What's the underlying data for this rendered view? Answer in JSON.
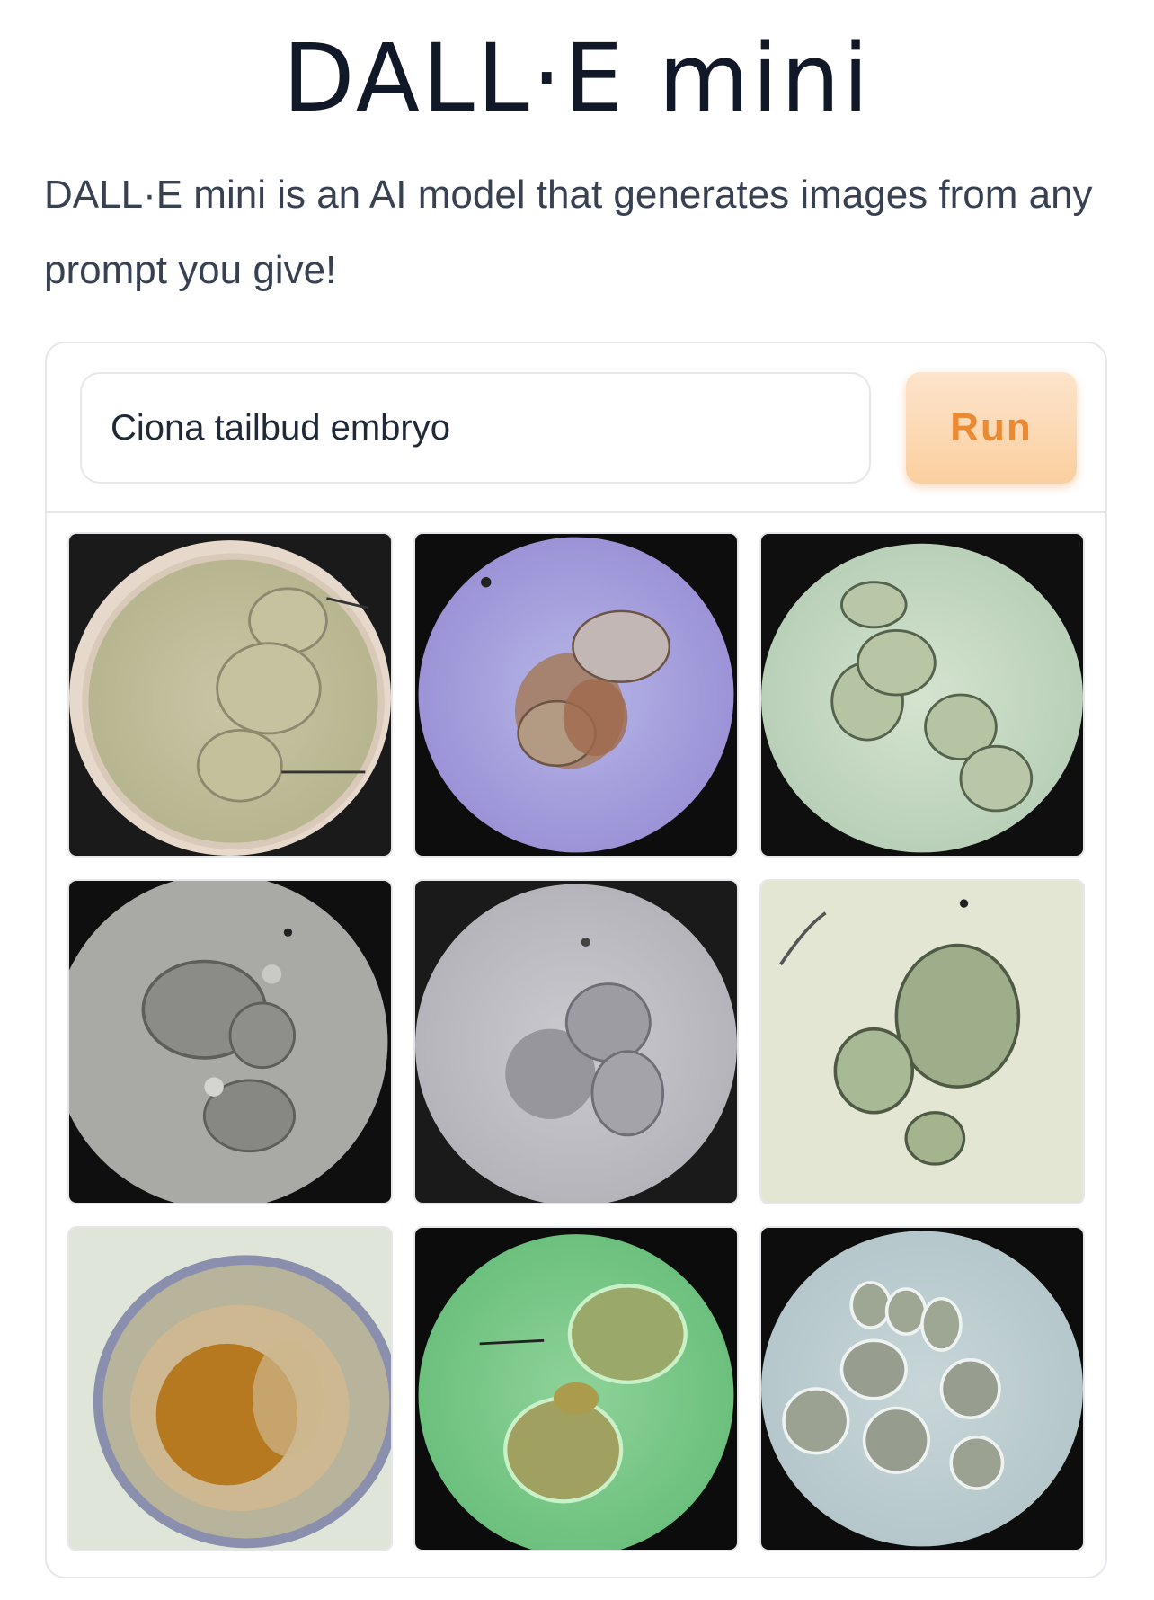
{
  "header": {
    "title": "DALL·E mini",
    "description": "DALL·E mini is an AI model that generates images from any prompt you give!"
  },
  "prompt": {
    "value": "Ciona tailbud embryo",
    "placeholder": ""
  },
  "run_button": {
    "label": "Run"
  },
  "colors": {
    "accent": "#ea8a32",
    "button_bg": "#fbcf9f",
    "border": "#e5e7eb",
    "text": "#111827"
  },
  "results": {
    "count": 9,
    "images": [
      "embryo-1",
      "embryo-2",
      "embryo-3",
      "embryo-4",
      "embryo-5",
      "embryo-6",
      "embryo-7",
      "embryo-8",
      "embryo-9"
    ]
  }
}
